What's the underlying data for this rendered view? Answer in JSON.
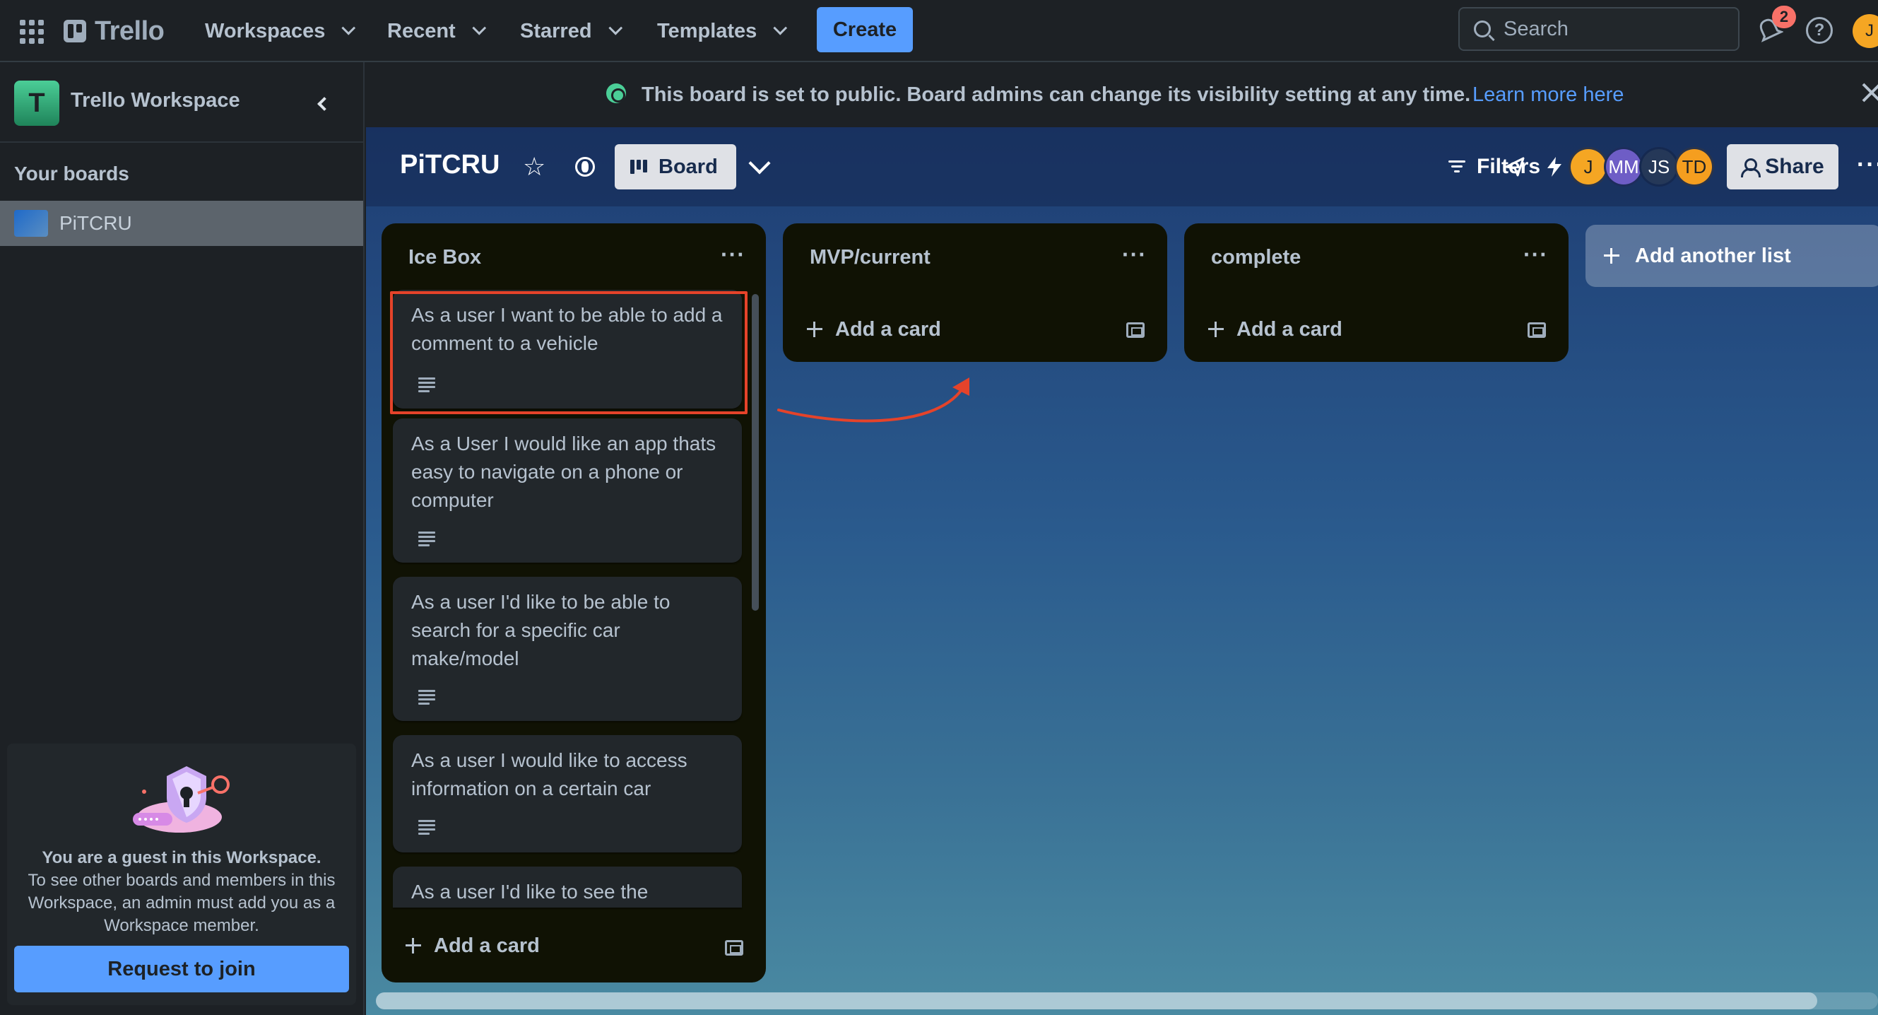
{
  "topnav": {
    "brand": "Trello",
    "menus": [
      {
        "label": "Workspaces"
      },
      {
        "label": "Recent"
      },
      {
        "label": "Starred"
      },
      {
        "label": "Templates"
      }
    ],
    "create_label": "Create",
    "search_placeholder": "Search",
    "notification_count": "2",
    "help_glyph": "?",
    "user_initial": "J"
  },
  "sidebar": {
    "workspace_initial": "T",
    "workspace_name": "Trello Workspace",
    "your_boards_label": "Your boards",
    "boards": [
      {
        "label": "PiTCRU"
      }
    ],
    "guest_title": "You are a guest in this Workspace.",
    "guest_body": "To see other boards and members in this Workspace, an admin must add you as a Workspace member.",
    "request_label": "Request to join"
  },
  "banner": {
    "text": "This board is set to public. Board admins can change its visibility setting at any time.",
    "link": "Learn more here"
  },
  "board_header": {
    "title": "PiTCRU",
    "view_label": "Board",
    "filters_label": "Filters",
    "members": [
      {
        "initials": "J",
        "color": "#f5a623"
      },
      {
        "initials": "MM",
        "color": "#6e5dc6"
      },
      {
        "initials": "JS",
        "color": "#253858"
      },
      {
        "initials": "TD",
        "color": "#f59e1f"
      }
    ],
    "share_label": "Share"
  },
  "lists": [
    {
      "title": "Ice Box",
      "cards": [
        {
          "text": "As a user I want to be able to add a comment to a vehicle"
        },
        {
          "text": "As a User I would like an app thats easy to navigate on a phone or computer"
        },
        {
          "text": "As a user I'd like to be able to search for a specific car make/model"
        },
        {
          "text": "As a user I would like to access information on a certain car"
        },
        {
          "text": "As a user I'd like to see the"
        }
      ],
      "add_card_label": "Add a card"
    },
    {
      "title": "MVP/current",
      "cards": [],
      "add_card_label": "Add a card"
    },
    {
      "title": "complete",
      "cards": [],
      "add_card_label": "Add a card"
    }
  ],
  "add_list_label": "Add another list",
  "colors": {
    "accent": "#579dff",
    "annotation_red": "#e5432a",
    "list_bg": "#101204",
    "card_bg": "#22272b"
  }
}
